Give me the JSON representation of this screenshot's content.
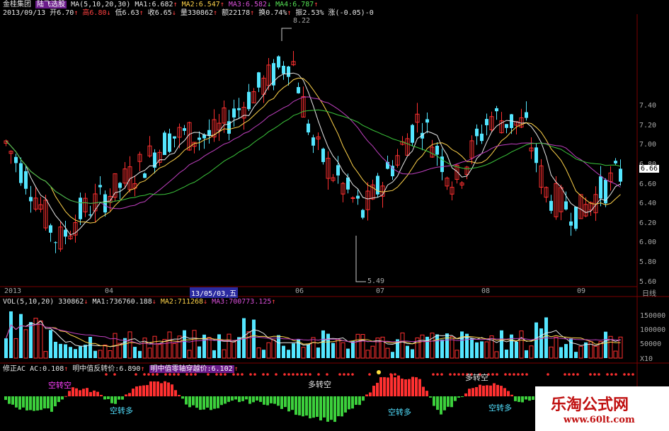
{
  "header": {
    "stock_name": "金桂集团",
    "formula_name": "陆飞选股",
    "ma_params": "MA(5,10,20,30)",
    "ma1": "MA1:6.682",
    "ma2": "MA2:6.547",
    "ma3": "MA3:6.582",
    "ma4": "MA4:6.787",
    "date": "2013/09/13",
    "open": "开6.70",
    "high": "高6.80",
    "low": "低6.63",
    "close": "收6.65",
    "volume": "量330862",
    "amount": "额22178",
    "turnover": "换0.74%",
    "amplitude": "振2.53%",
    "change": "涨(-0.05)-0"
  },
  "price_axis": {
    "ticks": [
      "7.40",
      "7.20",
      "7.00",
      "6.80",
      "6.60",
      "6.40",
      "6.20",
      "6.00",
      "5.80",
      "5.60"
    ],
    "current": "6.66",
    "high_label": "8.22",
    "low_label": "5.49"
  },
  "time_axis": {
    "labels": [
      "2013",
      "04",
      "06",
      "07",
      "08",
      "09"
    ],
    "cursor": "13/05/03,五",
    "period": "日线"
  },
  "volume_panel": {
    "title": "VOL(5,10,20)",
    "value": "330862",
    "ma1": "MA1:736760.188",
    "ma2": "MA2:711268",
    "ma3": "MA3:700773.125",
    "ticks": [
      "150000",
      "100000",
      "50000"
    ],
    "unit": "X10"
  },
  "indicator_panel": {
    "title": "修正AC",
    "ac": "AC:0.108",
    "reverse": "明中值反转价:6.890",
    "cross": "明中值零轴穿越价:6.102",
    "signals": {
      "kong_zhuan_kong": "空转空",
      "duo_zhuan_kong_1": "多转空",
      "duo_zhuan_kong_2": "多转空",
      "kong_zhuan_duo_1": "空转多",
      "kong_zhuan_duo_2": "空转多",
      "kong_zhuan_duo_3": "空转多"
    }
  },
  "watermark": {
    "name": "乐淘公式网",
    "url": "www.60lt.com"
  },
  "colors": {
    "up": "#ff3030",
    "down": "#54e6ff",
    "ma_white": "#e8e8e8",
    "ma_yellow": "#ffd34a",
    "ma_magenta": "#c040c0",
    "ma_green": "#3cc83c"
  }
}
